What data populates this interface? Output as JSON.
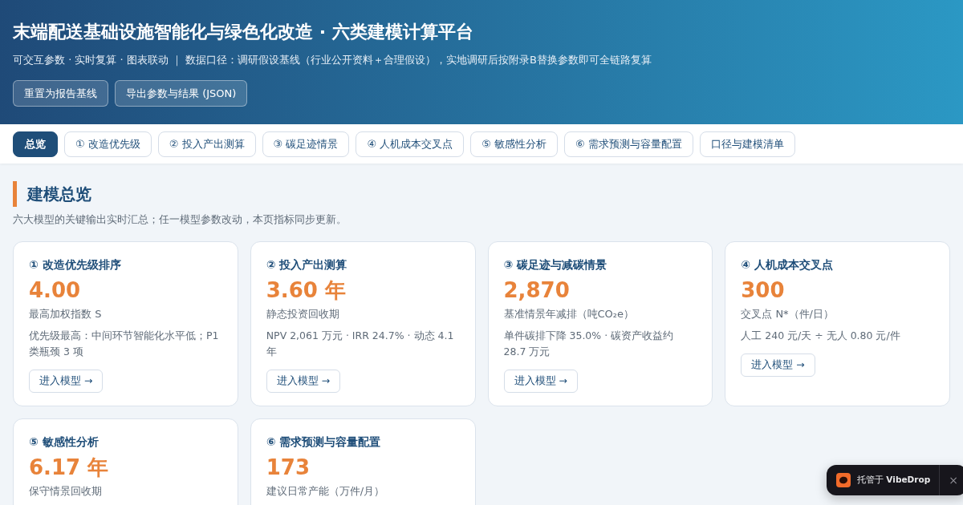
{
  "header": {
    "title": "末端配送基础设施智能化与绿色化改造 · 六类建模计算平台",
    "subtitle": "可交互参数 · 实时复算 · 图表联动 ｜ 数据口径：调研假设基线（行业公开资料＋合理假设），实地调研后按附录B替换参数即可全链路复算",
    "buttons": [
      "重置为报告基线",
      "导出参数与结果 (JSON)"
    ]
  },
  "tabs": [
    {
      "label": "总览",
      "selected": true
    },
    {
      "label": "① 改造优先级",
      "selected": false
    },
    {
      "label": "② 投入产出测算",
      "selected": false
    },
    {
      "label": "③ 碳足迹情景",
      "selected": false
    },
    {
      "label": "④ 人机成本交叉点",
      "selected": false
    },
    {
      "label": "⑤ 敏感性分析",
      "selected": false
    },
    {
      "label": "⑥ 需求预测与容量配置",
      "selected": false
    },
    {
      "label": "口径与建模清单",
      "selected": false
    }
  ],
  "section": {
    "title": "建模总览",
    "description": "六大模型的关键输出实时汇总；任一模型参数改动，本页指标同步更新。"
  },
  "cards": [
    {
      "title": "① 改造优先级排序",
      "value": "4.00",
      "label": "最高加权指数 S",
      "detail": "优先级最高：中间环节智能化水平低；P1 类瓶颈 3 项",
      "button": "进入模型 →"
    },
    {
      "title": "② 投入产出测算",
      "value": "3.60 年",
      "label": "静态投资回收期",
      "detail": "NPV 2,061 万元 · IRR 24.7% · 动态 4.1 年",
      "button": "进入模型 →"
    },
    {
      "title": "③ 碳足迹与减碳情景",
      "value": "2,870",
      "label": "基准情景年减排（吨CO₂e）",
      "detail": "单件碳排下降 35.0% · 碳资产收益约 28.7 万元",
      "button": "进入模型 →"
    },
    {
      "title": "④ 人机成本交叉点",
      "value": "300",
      "label": "交叉点 N*（件/日）",
      "detail": "人工 240 元/天 ÷ 无人 0.80 元/件",
      "button": "进入模型 →"
    },
    {
      "title": "⑤ 敏感性分析",
      "value": "6.17 年",
      "label": "保守情景回收期"
    },
    {
      "title": "⑥ 需求预测与容量配置",
      "value": "173",
      "label": "建议日常产能（万件/月）"
    }
  ],
  "badge": {
    "text": "托管于 **VibeDrop**",
    "close": "×"
  }
}
